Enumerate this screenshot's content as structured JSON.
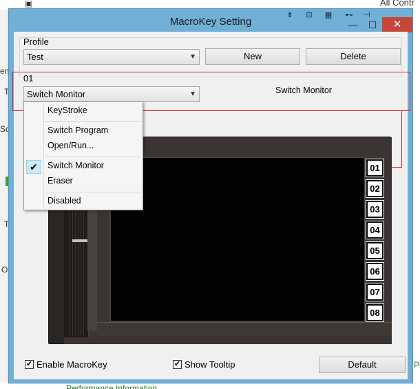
{
  "background": {
    "top_right_text": "All Contr",
    "left_fragments": [
      "en",
      "T",
      "Sc",
      "T",
      "O"
    ],
    "right_fragment": "Pe",
    "bottom_text": "Performance  Information  ..."
  },
  "window": {
    "title": "MacroKey Setting",
    "close_glyph": "✕",
    "minimize_glyph": "—",
    "maximize_glyph": "☐"
  },
  "profile": {
    "label": "Profile",
    "selected": "Test",
    "new_button": "New",
    "delete_button": "Delete"
  },
  "key_setting": {
    "key_label": "01",
    "selected_action": "Switch Monitor",
    "action_description": "Switch Monitor"
  },
  "action_menu": {
    "items": [
      {
        "label": "KeyStroke",
        "checked": false
      },
      {
        "label": "Switch Program",
        "checked": false
      },
      {
        "label": "Open/Run...",
        "checked": false
      },
      {
        "label": "Switch Monitor",
        "checked": true
      },
      {
        "label": "Eraser",
        "checked": false
      },
      {
        "label": "Disabled",
        "checked": false
      }
    ],
    "check_glyph": "✔"
  },
  "tablet": {
    "keys": [
      "01",
      "02",
      "03",
      "04",
      "05",
      "06",
      "07",
      "08"
    ],
    "selected_key": "01"
  },
  "footer": {
    "enable_macrokey_label": "Enable MacroKey",
    "enable_macrokey_checked": true,
    "show_tooltip_label": "Show Tooltip",
    "show_tooltip_checked": true,
    "default_button": "Default",
    "check_glyph": "✔"
  },
  "colors": {
    "frame": "#70b0d6",
    "close": "#c7463a",
    "highlight_red": "#d81e2a",
    "menu_check": "#cde8f7"
  }
}
